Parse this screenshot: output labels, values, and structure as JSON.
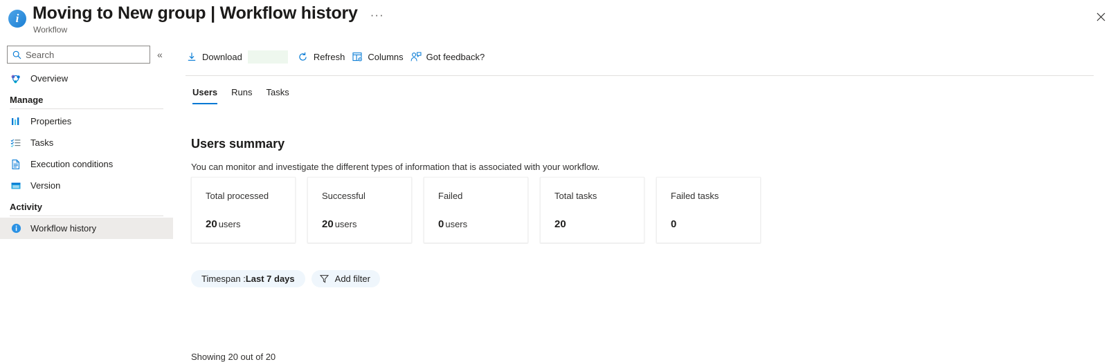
{
  "header": {
    "info_icon": "info-circle-icon",
    "title": "Moving to New group | Workflow history",
    "ellipsis": "···",
    "subtitle": "Workflow",
    "close_label": "✕"
  },
  "sidebar": {
    "search": {
      "placeholder": "Search",
      "value": "",
      "icon": "search-icon"
    },
    "collapse_icon": "«",
    "overview": {
      "label": "Overview",
      "icon": "overview-icon"
    },
    "groups": [
      {
        "label": "Manage",
        "items": [
          {
            "label": "Properties",
            "icon": "properties-bars-icon"
          },
          {
            "label": "Tasks",
            "icon": "tasks-checklist-icon"
          },
          {
            "label": "Execution conditions",
            "icon": "document-icon"
          },
          {
            "label": "Version",
            "icon": "version-window-icon"
          }
        ]
      },
      {
        "label": "Activity",
        "items": [
          {
            "label": "Workflow history",
            "icon": "info-circle-icon",
            "selected": true
          }
        ]
      }
    ]
  },
  "toolbar": {
    "commands": [
      {
        "label": "Download",
        "icon": "download-arrow-icon"
      },
      {
        "label": "Refresh",
        "icon": "refresh-icon"
      },
      {
        "label": "Columns",
        "icon": "columns-settings-icon"
      },
      {
        "label": "Got feedback?",
        "icon": "feedback-person-icon"
      }
    ]
  },
  "tabs": [
    {
      "label": "Users",
      "active": true
    },
    {
      "label": "Runs",
      "active": false
    },
    {
      "label": "Tasks",
      "active": false
    }
  ],
  "content": {
    "section_title": "Users summary",
    "section_desc": "You can monitor and investigate the different types of information that is associated with your workflow.",
    "cards": [
      {
        "label": "Total processed",
        "value": "20",
        "unit": "users"
      },
      {
        "label": "Successful",
        "value": "20",
        "unit": "users"
      },
      {
        "label": "Failed",
        "value": "0",
        "unit": "users"
      },
      {
        "label": "Total tasks",
        "value": "20",
        "unit": ""
      },
      {
        "label": "Failed tasks",
        "value": "0",
        "unit": ""
      }
    ],
    "filters": {
      "timespan_prefix": "Timespan : ",
      "timespan_value": "Last 7 days",
      "add_filter_label": "Add filter",
      "add_filter_icon": "funnel-icon"
    },
    "showing": "Showing 20 out of 20"
  },
  "colors": {
    "accent": "#0078d4",
    "pill_bg": "#eff6fc",
    "selected_nav_bg": "#edebe9",
    "download_highlight": "#eef7ee"
  }
}
